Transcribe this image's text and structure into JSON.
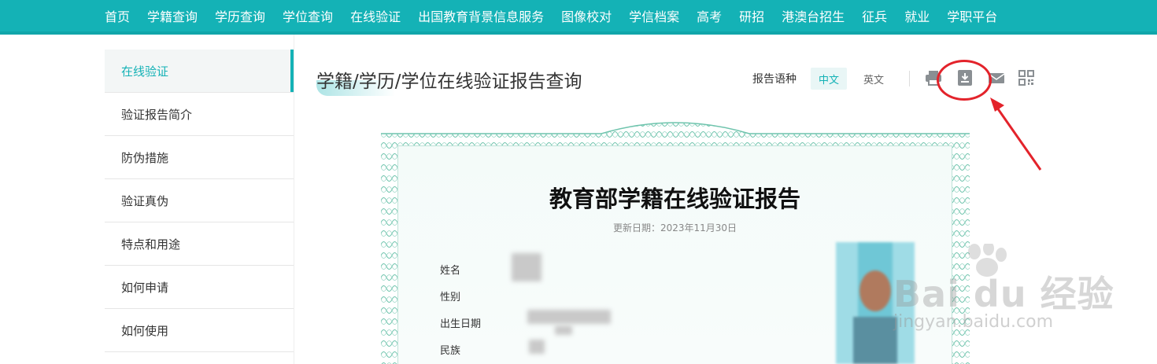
{
  "topnav": {
    "items": [
      "首页",
      "学籍查询",
      "学历查询",
      "学位查询",
      "在线验证",
      "出国教育背景信息服务",
      "图像校对",
      "学信档案",
      "高考",
      "研招",
      "港澳台招生",
      "征兵",
      "就业",
      "学职平台"
    ]
  },
  "sidebar": {
    "items": [
      {
        "label": "在线验证",
        "active": true
      },
      {
        "label": "验证报告简介"
      },
      {
        "label": "防伪措施"
      },
      {
        "label": "验证真伪"
      },
      {
        "label": "特点和用途"
      },
      {
        "label": "如何申请"
      },
      {
        "label": "如何使用"
      }
    ]
  },
  "header": {
    "title": "学籍/学历/学位在线验证报告查询",
    "lang_label": "报告语种",
    "lang_zh": "中文",
    "lang_en": "英文",
    "icons": [
      "print-icon",
      "download-icon",
      "mail-icon",
      "qrcode-icon"
    ]
  },
  "report": {
    "title": "教育部学籍在线验证报告",
    "updated": "更新日期：2023年11月30日",
    "fields": [
      "姓名",
      "性别",
      "出生日期",
      "民族"
    ]
  },
  "watermark": {
    "brand": "Bai du 经验",
    "url": "jingyan.baidu.com"
  },
  "colors": {
    "brand": "#14b2b6",
    "annotation": "#e3232b"
  }
}
